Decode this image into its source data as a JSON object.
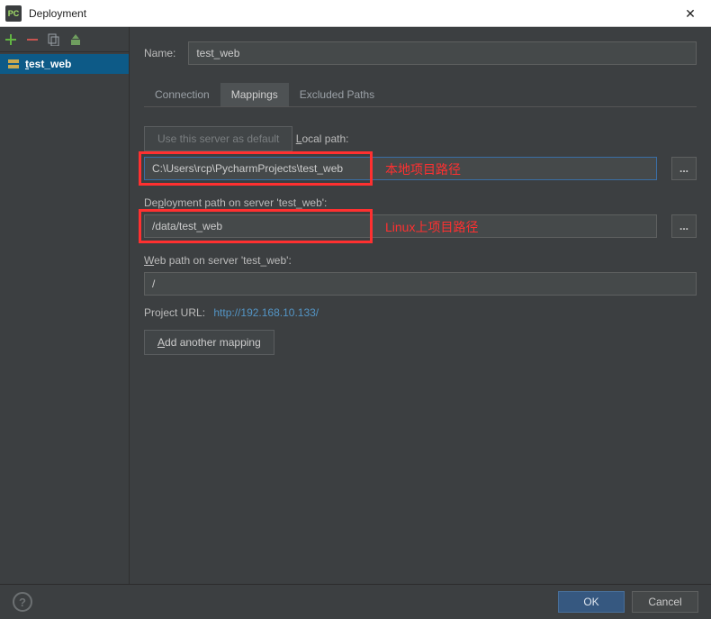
{
  "window": {
    "icon_label": "PC",
    "title": "Deployment",
    "close_glyph": "✕"
  },
  "sidebar": {
    "tool_add_title": "Add",
    "tool_remove_title": "Remove",
    "tool_copy_title": "Copy",
    "tool_autoupload_title": "Auto-upload",
    "items": [
      {
        "label": "test_web",
        "selected": true
      }
    ]
  },
  "content": {
    "name_label": "Name:",
    "name_value": "test_web",
    "tabs": [
      {
        "label": "Connection",
        "active": false
      },
      {
        "label": "Mappings",
        "active": true
      },
      {
        "label": "Excluded Paths",
        "active": false
      }
    ],
    "default_button": "Use this server as default",
    "local_path_label": "Local path:",
    "local_path_value": "C:\\Users\\rcp\\PycharmProjects\\test_web",
    "browse_glyph": "...",
    "deployment_path_label": "Deployment path on server 'test_web':",
    "deployment_path_value": "/data/test_web",
    "web_path_label": "Web path on server 'test_web':",
    "web_path_value": "/",
    "project_url_label": "Project URL:",
    "project_url_value": "http://192.168.10.133/",
    "add_mapping_label": "Add another mapping"
  },
  "annotations": {
    "local_path_note": "本地项目路径",
    "deployment_path_note": "Linux上项目路径"
  },
  "footer": {
    "help_glyph": "?",
    "ok_label": "OK",
    "cancel_label": "Cancel"
  }
}
